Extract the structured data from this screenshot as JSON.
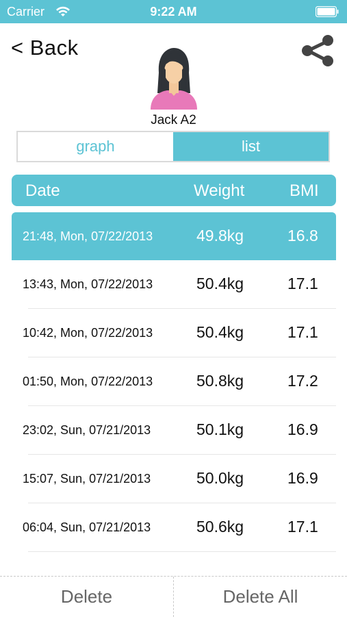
{
  "status_bar": {
    "carrier": "Carrier",
    "time": "9:22 AM",
    "wifi_icon": "wifi-icon",
    "battery_icon": "battery-icon"
  },
  "header": {
    "back_label": "< Back",
    "share_icon": "share-icon",
    "user_name": "Jack A2"
  },
  "segments": [
    {
      "label": "graph",
      "selected": false
    },
    {
      "label": "list",
      "selected": true
    }
  ],
  "table": {
    "columns": [
      "Date",
      "Weight",
      "BMI"
    ],
    "rows": [
      {
        "date": "21:48, Mon, 07/22/2013",
        "weight": "49.8kg",
        "bmi": "16.8",
        "selected": true
      },
      {
        "date": "13:43, Mon, 07/22/2013",
        "weight": "50.4kg",
        "bmi": "17.1"
      },
      {
        "date": "10:42, Mon, 07/22/2013",
        "weight": "50.4kg",
        "bmi": "17.1"
      },
      {
        "date": "01:50, Mon, 07/22/2013",
        "weight": "50.8kg",
        "bmi": "17.2"
      },
      {
        "date": "23:02, Sun, 07/21/2013",
        "weight": "50.1kg",
        "bmi": "16.9"
      },
      {
        "date": "15:07, Sun, 07/21/2013",
        "weight": "50.0kg",
        "bmi": "16.9"
      },
      {
        "date": "06:04, Sun, 07/21/2013",
        "weight": "50.6kg",
        "bmi": "17.1"
      }
    ]
  },
  "footer": {
    "delete_label": "Delete",
    "delete_all_label": "Delete All"
  },
  "colors": {
    "accent": "#5cc3d4",
    "footer_text": "#666666"
  }
}
